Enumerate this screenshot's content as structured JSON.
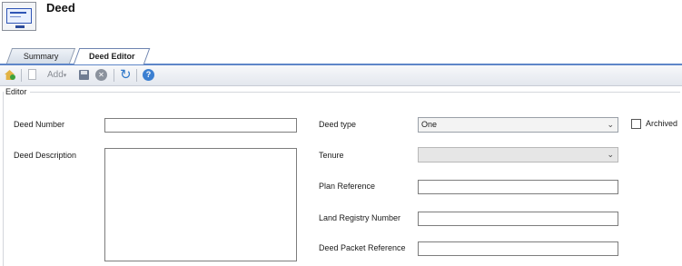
{
  "header": {
    "title": "Deed",
    "icon": "deed-certificate-icon"
  },
  "tabs": [
    {
      "label": "Summary",
      "active": false
    },
    {
      "label": "Deed Editor",
      "active": true
    }
  ],
  "toolbar": {
    "add_label": "Add",
    "icons": [
      "home-icon",
      "new-page-icon",
      "save-icon",
      "cancel-icon",
      "refresh-icon",
      "help-icon"
    ]
  },
  "editor": {
    "group_title": "Editor",
    "deed_number": {
      "label": "Deed Number",
      "value": ""
    },
    "deed_description": {
      "label": "Deed Description",
      "value": ""
    },
    "deed_type": {
      "label": "Deed type",
      "value": "One"
    },
    "archived": {
      "label": "Archived",
      "checked": false
    },
    "tenure": {
      "label": "Tenure",
      "value": ""
    },
    "plan_reference": {
      "label": "Plan Reference",
      "value": ""
    },
    "land_registry_number": {
      "label": "Land Registry Number",
      "value": ""
    },
    "deed_packet_reference": {
      "label": "Deed Packet Reference",
      "value": ""
    }
  },
  "colors": {
    "tab_accent": "#5f86c8",
    "toolbar_bg": "#e3e7ee"
  }
}
